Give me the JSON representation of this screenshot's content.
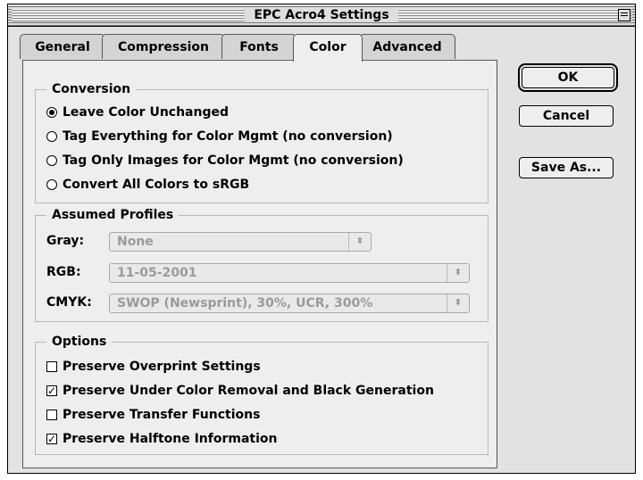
{
  "window": {
    "title": "EPC Acro4 Settings"
  },
  "tabs": [
    {
      "label": "General",
      "active": false
    },
    {
      "label": "Compression",
      "active": false
    },
    {
      "label": "Fonts",
      "active": false
    },
    {
      "label": "Color",
      "active": true
    },
    {
      "label": "Advanced",
      "active": false
    }
  ],
  "conversion": {
    "legend": "Conversion",
    "options": [
      {
        "label": "Leave Color Unchanged",
        "selected": true
      },
      {
        "label": "Tag Everything for Color Mgmt (no conversion)",
        "selected": false
      },
      {
        "label": "Tag Only Images for Color Mgmt (no conversion)",
        "selected": false
      },
      {
        "label": "Convert All Colors to sRGB",
        "selected": false
      }
    ]
  },
  "profiles": {
    "legend": "Assumed Profiles",
    "gray": {
      "label": "Gray:",
      "value": "None"
    },
    "rgb": {
      "label": "RGB:",
      "value": "11-05-2001"
    },
    "cmyk": {
      "label": "CMYK:",
      "value": "SWOP (Newsprint), 30%, UCR, 300%"
    }
  },
  "options": {
    "legend": "Options",
    "items": [
      {
        "label": "Preserve Overprint Settings",
        "checked": false
      },
      {
        "label": "Preserve Under Color Removal and Black Generation",
        "checked": true
      },
      {
        "label": "Preserve Transfer Functions",
        "checked": false
      },
      {
        "label": "Preserve Halftone Information",
        "checked": true
      }
    ]
  },
  "buttons": {
    "ok": "OK",
    "cancel": "Cancel",
    "save_as": "Save As..."
  },
  "glyphs": {
    "popup_arrows": "⬍",
    "check_mark": "✓"
  }
}
